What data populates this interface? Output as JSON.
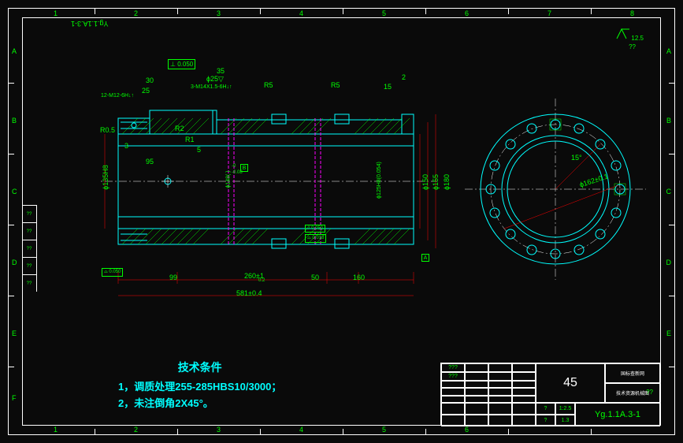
{
  "grid": {
    "cols": [
      "1",
      "2",
      "3",
      "4",
      "5",
      "6",
      "7",
      "8"
    ],
    "rows": [
      "A",
      "B",
      "C",
      "D",
      "E",
      "F"
    ]
  },
  "drawing_number_top": "Yg.1.1A.3-1",
  "roughness_corner": "12.5",
  "roughness_note": "??",
  "tolerance_frames": {
    "perpendicularity": "⊥ 0.050",
    "runout_b": "⌓ 0.050",
    "gd1": "// 0.050",
    "gd2": "⌓ 0.015"
  },
  "dimensions": {
    "thread_left": "12-M12-6H↓↑",
    "thread_mid": "3-M14X1.5-6H↓↑",
    "d_30": "30",
    "d_25": "25",
    "d_35": "35",
    "d_phi25": "ϕ25▽",
    "r05": "R0.5",
    "r2": "R2",
    "r1": "R1",
    "d_3": "3",
    "d_5": "5",
    "d_95": "95",
    "r5_1": "R5",
    "r5_2": "R5",
    "d_15": "15",
    "d_2": "2",
    "phi135": "ϕ135H8",
    "phi148": "ϕ148( )",
    "phi148_tol_u": "-0",
    "phi148_tol_l": "-0.08",
    "phi125": "ϕ125H8(0.054)",
    "phi125_tol": "+0.054/0",
    "phi150": "ϕ150",
    "phi155": "ϕ155",
    "phi180": "ϕ180",
    "d_99": "99",
    "d_260": "260±1",
    "d_260_sub": "0.2",
    "d_50": "50",
    "d_160": "160",
    "d_581": "581±0.4",
    "angle_15": "15°",
    "phi162": "ϕ162±0.1"
  },
  "datums": {
    "a": "A",
    "b": "B"
  },
  "tech_notes": {
    "title": "技术条件",
    "line1": "1，调质处理255-285HBS10/3000；",
    "line2": "2，未注倒角2X45°。"
  },
  "title_block": {
    "part_num": "45",
    "dwg_num": "Yg.1.1A.3-1",
    "scale": "1:2.5",
    "company1": "国标查新网",
    "company2": "技术资源机械图",
    "qty": "??",
    "mat": "1.3",
    "cells": [
      "???",
      "",
      "",
      "",
      "???",
      "",
      "",
      "",
      ""
    ]
  },
  "revisions": [
    "??",
    "??",
    "??",
    "??",
    "??"
  ]
}
